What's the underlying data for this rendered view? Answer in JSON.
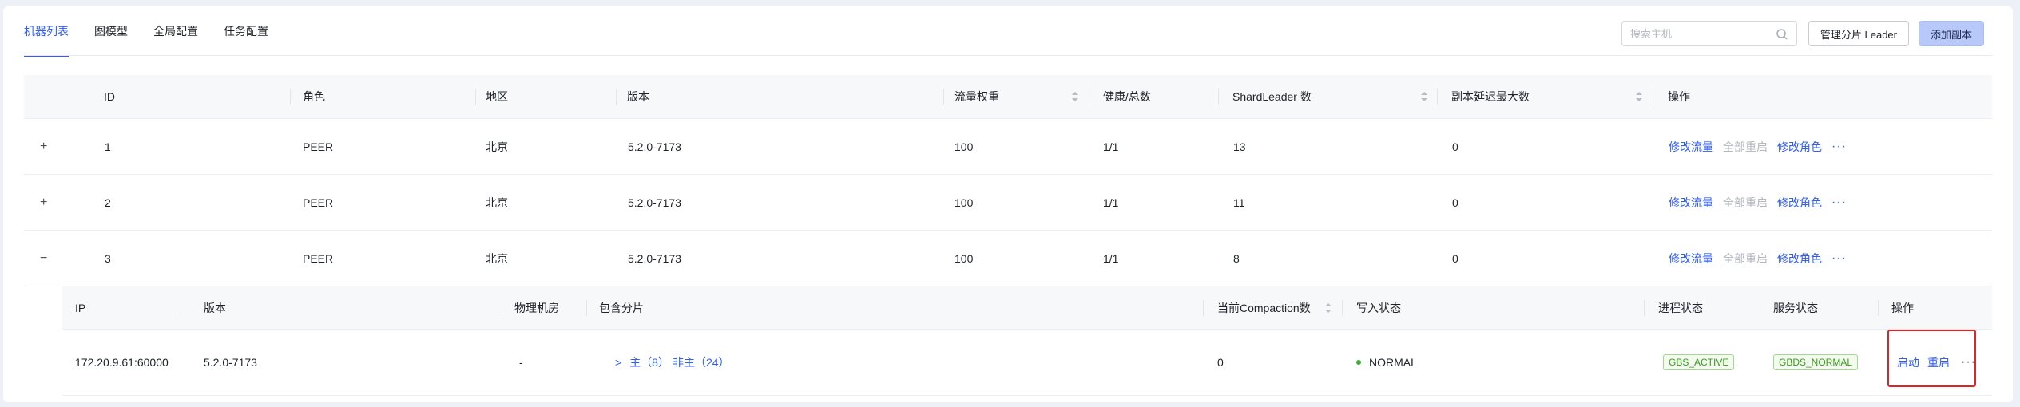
{
  "tabs": [
    "机器列表",
    "图模型",
    "全局配置",
    "任务配置"
  ],
  "search": {
    "placeholder": "搜索主机"
  },
  "buttons": {
    "manage_leader": "管理分片 Leader",
    "add_replica": "添加副本"
  },
  "table": {
    "headers": {
      "id": "ID",
      "role": "角色",
      "region": "地区",
      "version": "版本",
      "weight": "流量权重",
      "health": "健康/总数",
      "shard_leader": "ShardLeader 数",
      "max_delay": "副本延迟最大数",
      "ops": "操作"
    },
    "rows": [
      {
        "expander": "+",
        "id": "1",
        "role": "PEER",
        "region": "北京",
        "version": "5.2.0-7173",
        "weight": "100",
        "health": "1/1",
        "shard_leader": "13",
        "max_delay": "0"
      },
      {
        "expander": "+",
        "id": "2",
        "role": "PEER",
        "region": "北京",
        "version": "5.2.0-7173",
        "weight": "100",
        "health": "1/1",
        "shard_leader": "11",
        "max_delay": "0"
      },
      {
        "expander": "−",
        "id": "3",
        "role": "PEER",
        "region": "北京",
        "version": "5.2.0-7173",
        "weight": "100",
        "health": "1/1",
        "shard_leader": "8",
        "max_delay": "0"
      }
    ],
    "row_actions": {
      "modify_weight": "修改流量",
      "restart_all": "全部重启",
      "modify_role": "修改角色",
      "more": "···"
    }
  },
  "sub_table": {
    "headers": {
      "ip": "IP",
      "version": "版本",
      "room": "物理机房",
      "shards": "包含分片",
      "compaction": "当前Compaction数",
      "write_state": "写入状态",
      "process_state": "进程状态",
      "service_state": "服务状态",
      "ops": "操作"
    },
    "row": {
      "ip": "172.20.9.61:60000",
      "version": "5.2.0-7173",
      "room": "-",
      "shards_toggle": ">",
      "shards_main": "主（8）",
      "shards_non_main": "非主（24）",
      "compaction": "0",
      "write_state": "NORMAL",
      "process_state": "GBS_ACTIVE",
      "service_state": "GBDS_NORMAL",
      "start": "启动",
      "restart": "重启",
      "more": "···"
    }
  }
}
